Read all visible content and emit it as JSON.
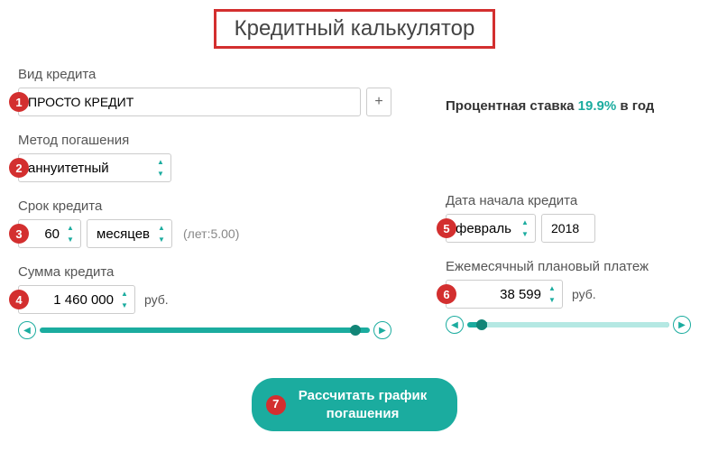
{
  "title": "Кредитный калькулятор",
  "badges": {
    "b1": "1",
    "b2": "2",
    "b3": "3",
    "b4": "4",
    "b5": "5",
    "b6": "6",
    "b7": "7"
  },
  "creditType": {
    "label": "Вид кредита",
    "value": "ПРОСТО КРЕДИТ",
    "plus": "+"
  },
  "rate": {
    "prefix": "Процентная ставка ",
    "value": "19.9%",
    "suffix": " в год"
  },
  "method": {
    "label": "Метод погашения",
    "value": "аннуитетный"
  },
  "term": {
    "label": "Срок кредита",
    "value": "60",
    "unit": "месяцев",
    "hint": "(лет:5.00)"
  },
  "startDate": {
    "label": "Дата начала кредита",
    "month": "февраль",
    "year": "2018"
  },
  "amount": {
    "label": "Сумма кредита",
    "value": "1 460 000",
    "unit": "руб."
  },
  "payment": {
    "label": "Ежемесячный плановый платеж",
    "value": "38 599",
    "unit": "руб."
  },
  "calculate": "Рассчитать график\nпогашения"
}
